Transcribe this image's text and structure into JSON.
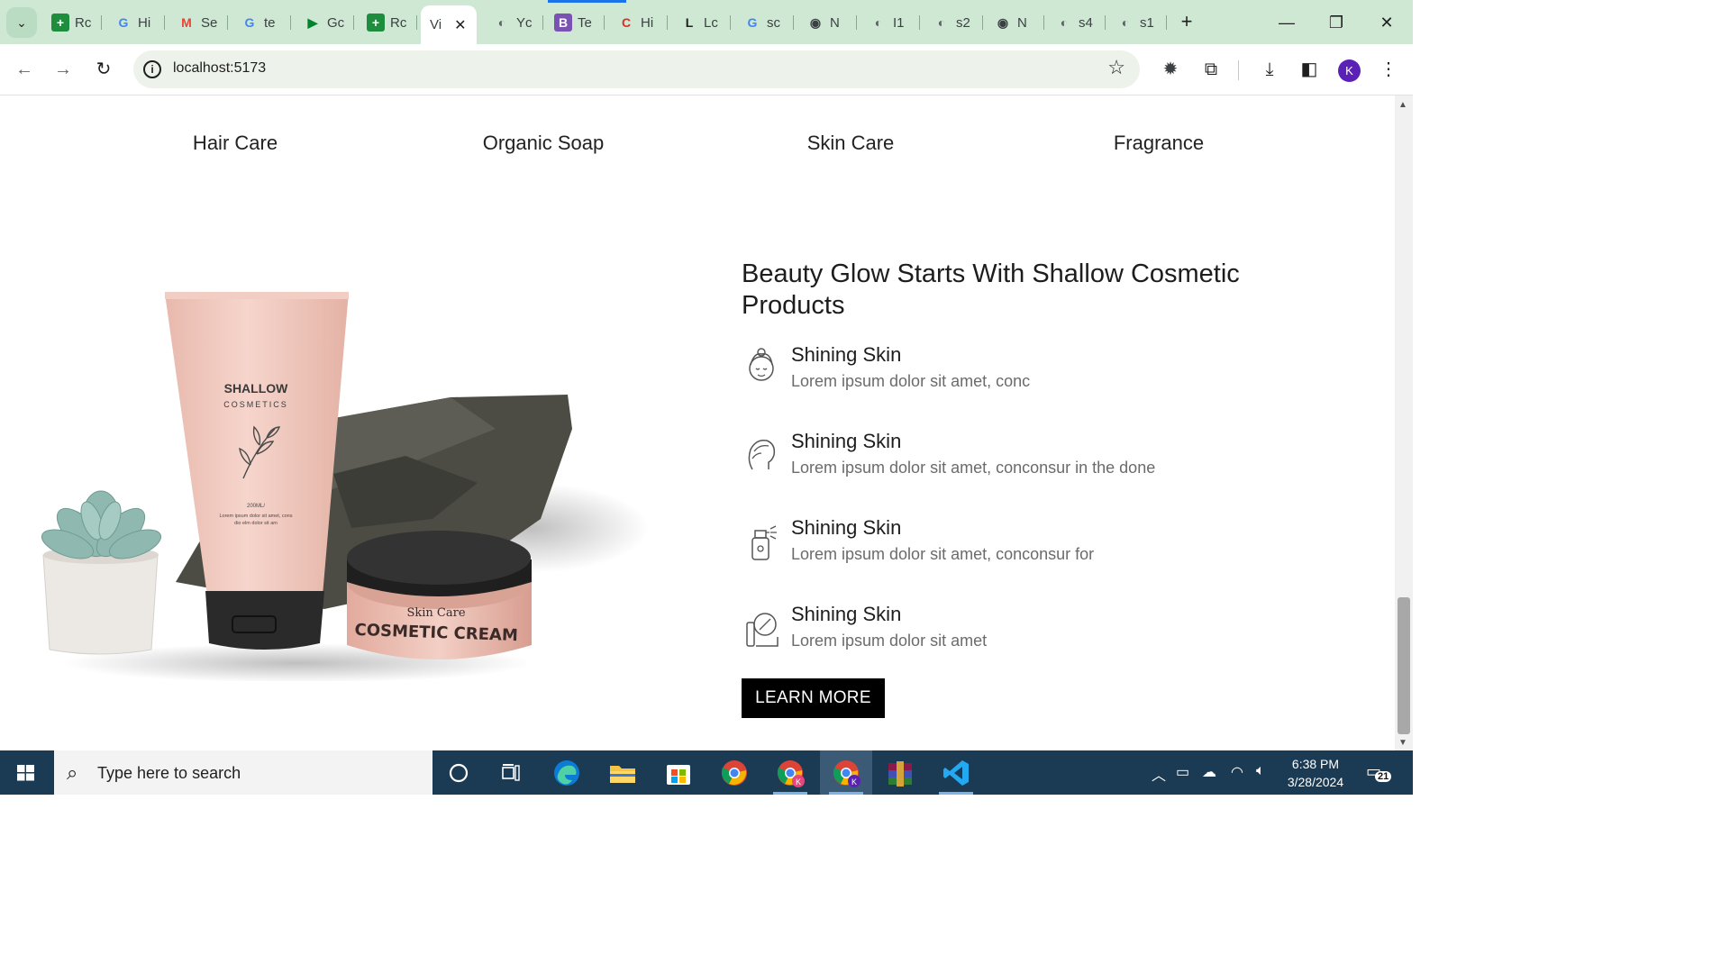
{
  "browser": {
    "tabs": [
      {
        "title": "Rc",
        "icon": "sheets-icon",
        "color": "#1e8e3e",
        "glyph": "+"
      },
      {
        "title": "Hi",
        "icon": "google-icon",
        "color": "#4285f4",
        "glyph": "G"
      },
      {
        "title": "Se",
        "icon": "gmail-icon",
        "color": "#ea4335",
        "glyph": "M"
      },
      {
        "title": "te",
        "icon": "google-icon",
        "color": "#4285f4",
        "glyph": "G"
      },
      {
        "title": "Gc",
        "icon": "meet-icon",
        "color": "#00832d",
        "glyph": "▶"
      },
      {
        "title": "Rc",
        "icon": "sheets-icon",
        "color": "#1e8e3e",
        "glyph": "+"
      },
      {
        "title": "Vi",
        "icon": "",
        "color": "#1f1f1f",
        "glyph": "",
        "active": true
      },
      {
        "title": "Yc",
        "icon": "globe-icon",
        "color": "#5f6368",
        "glyph": "◐"
      },
      {
        "title": "Te",
        "icon": "bootstrap-icon",
        "color": "#7952b3",
        "glyph": "B"
      },
      {
        "title": "Hi",
        "icon": "c-icon",
        "color": "#d93025",
        "glyph": "C"
      },
      {
        "title": "Lc",
        "icon": "l-icon",
        "color": "#1f1f1f",
        "glyph": "L"
      },
      {
        "title": "sc",
        "icon": "google-icon",
        "color": "#4285f4",
        "glyph": "G"
      },
      {
        "title": "N",
        "icon": "globe-icon",
        "color": "#3c4043",
        "glyph": "◉"
      },
      {
        "title": "I1",
        "icon": "globe-icon",
        "color": "#5f6368",
        "glyph": "◐"
      },
      {
        "title": "s2",
        "icon": "globe-icon",
        "color": "#5f6368",
        "glyph": "◐"
      },
      {
        "title": "N",
        "icon": "globe-icon",
        "color": "#3c4043",
        "glyph": "◉"
      },
      {
        "title": "s4",
        "icon": "globe-icon",
        "color": "#5f6368",
        "glyph": "◐"
      },
      {
        "title": "s1",
        "icon": "globe-icon",
        "color": "#5f6368",
        "glyph": "◐"
      }
    ],
    "url": "localhost:5173",
    "avatar_letter": "K"
  },
  "categories": [
    "Hair Care",
    "Organic Soap",
    "Skin Care",
    "Fragrance"
  ],
  "product_art": {
    "tube_brand": "SHALLOW",
    "tube_sub": "COSMETICS",
    "tube_volume": "200ML/",
    "tube_fine_print_1": "Lorem ipsum dolor sit amet, cons",
    "tube_fine_print_2": "dio elm dolor sit am",
    "jar_line1": "Skin Care",
    "jar_line2": "COSMETIC CREAM"
  },
  "section": {
    "headline": "Beauty Glow Starts With Shallow Cosmetic Products",
    "features": [
      {
        "title": "Shining Skin",
        "desc": "Lorem ipsum dolor sit amet, conc",
        "icon": "face-icon"
      },
      {
        "title": "Shining Skin",
        "desc": "Lorem ipsum dolor sit amet, conconsur in the done",
        "icon": "hair-profile-icon"
      },
      {
        "title": "Shining Skin",
        "desc": "Lorem ipsum dolor sit amet, conconsur for",
        "icon": "spray-bottle-icon"
      },
      {
        "title": "Shining Skin",
        "desc": "Lorem ipsum dolor sit amet",
        "icon": "mirror-brush-icon"
      }
    ],
    "cta_label": "LEARN MORE"
  },
  "taskbar": {
    "search_placeholder": "Type here to search",
    "time": "6:38 PM",
    "date": "3/28/2024",
    "notification_count": "21"
  }
}
